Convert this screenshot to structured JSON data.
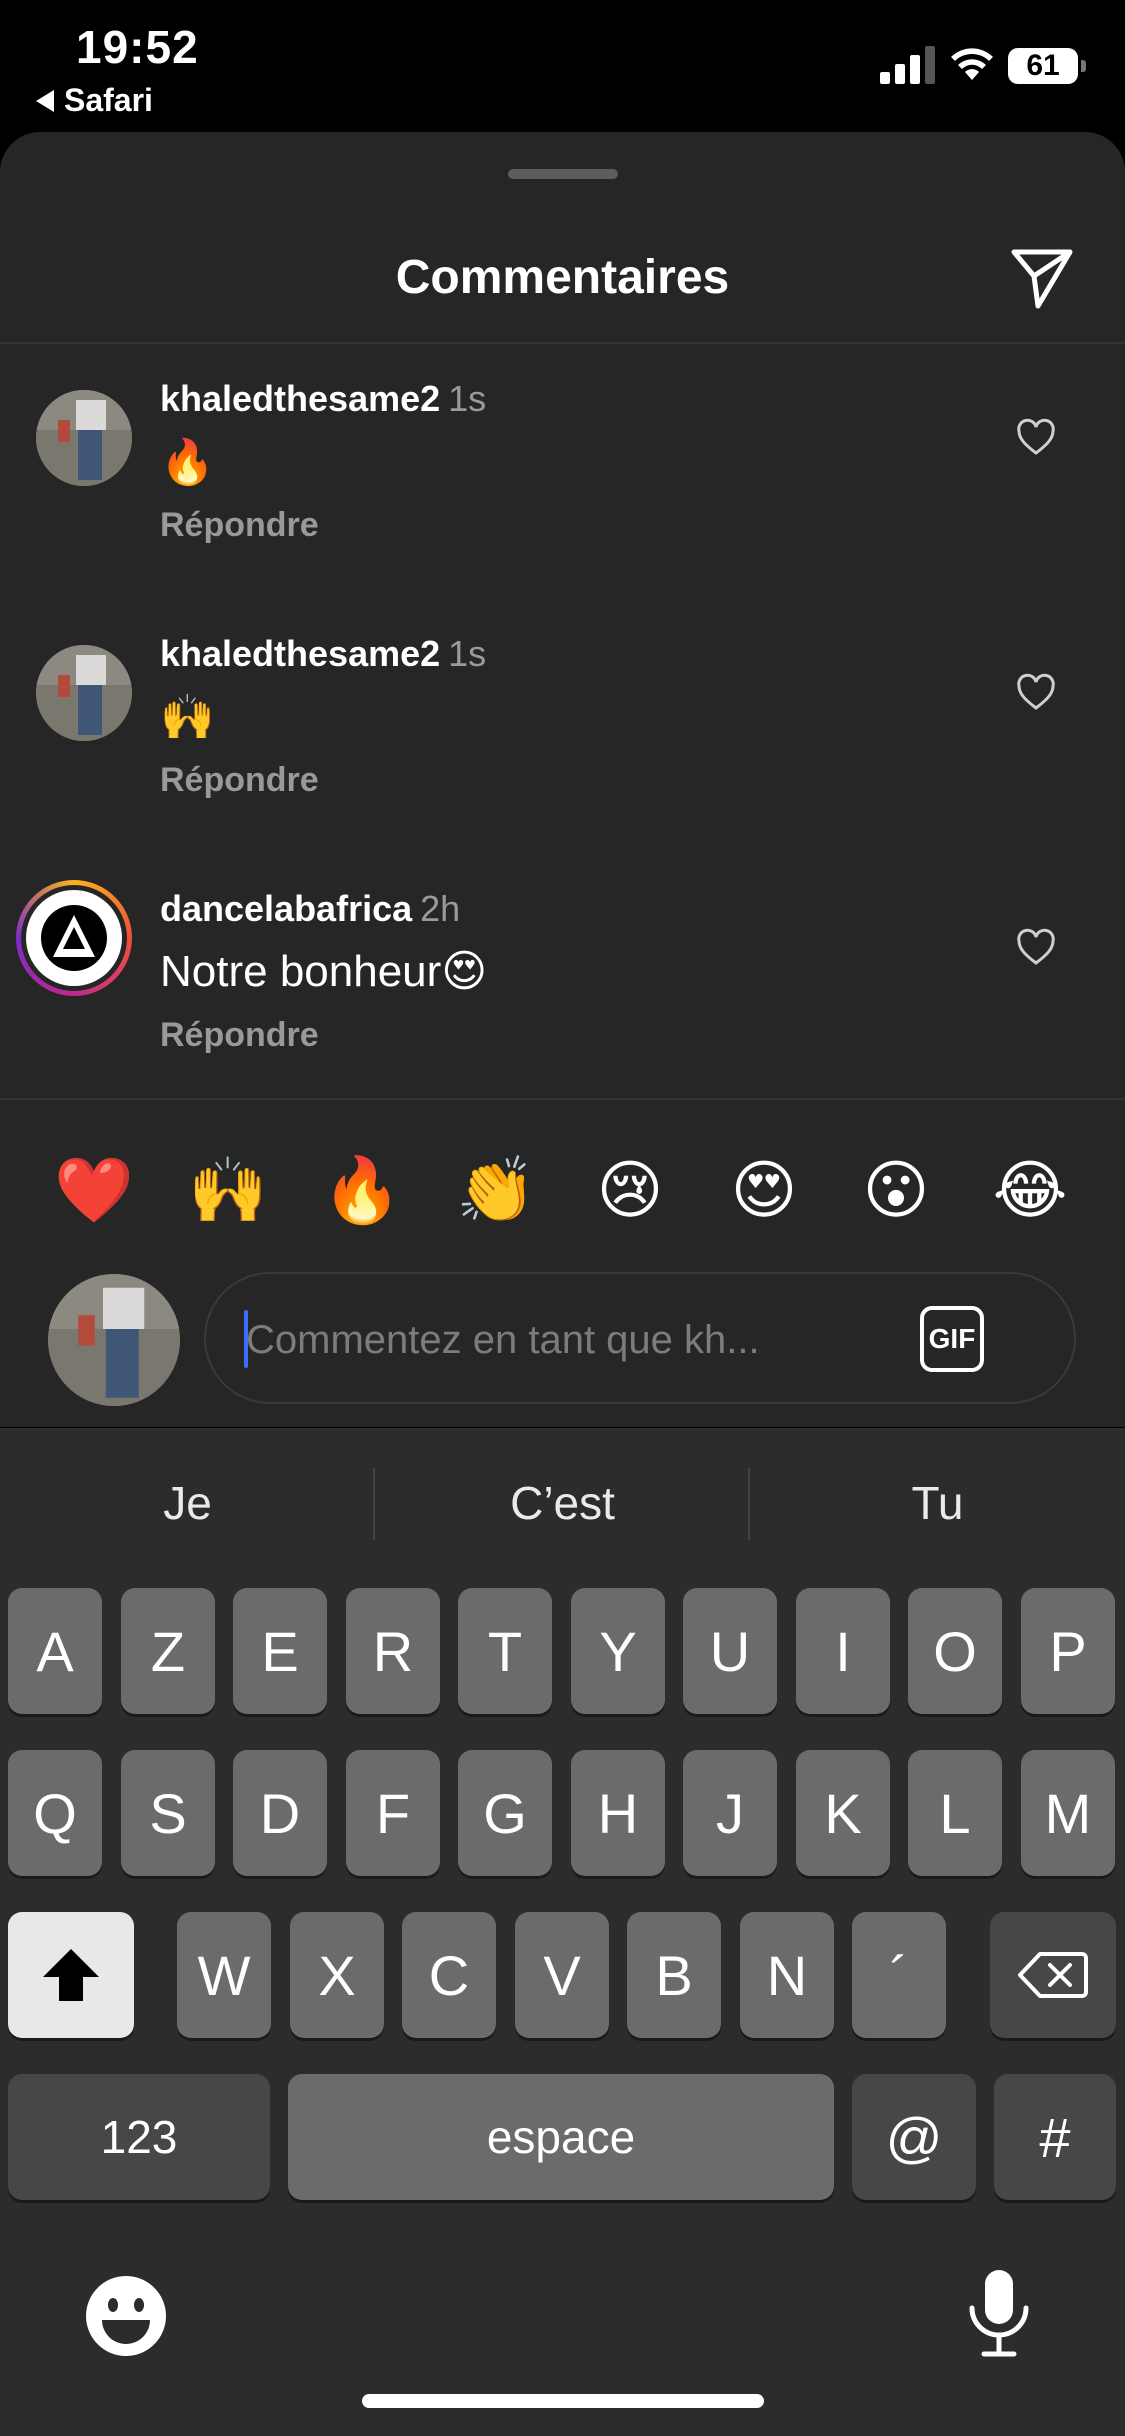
{
  "status_bar": {
    "time": "19:52",
    "back_app": "Safari",
    "battery": "61"
  },
  "sheet": {
    "title": "Commentaires"
  },
  "comments": [
    {
      "username": "khaledthesame2",
      "time": "1s",
      "text": "🔥",
      "reply": "Répondre"
    },
    {
      "username": "khaledthesame2",
      "time": "1s",
      "text": "🙌",
      "reply": "Répondre"
    },
    {
      "username": "dancelabafrica",
      "time": "2h",
      "text": "Notre bonheur😍",
      "reply": "Répondre"
    }
  ],
  "reactions": [
    "❤️",
    "🙌",
    "🔥",
    "👏",
    "😢",
    "😍",
    "😮",
    "😂"
  ],
  "composer": {
    "placeholder": "Commentez en tant que kh...",
    "value": "",
    "gif_label": "GIF"
  },
  "keyboard": {
    "suggestions": [
      "Je",
      "C’est",
      "Tu"
    ],
    "row1": [
      "A",
      "Z",
      "E",
      "R",
      "T",
      "Y",
      "U",
      "I",
      "O",
      "P"
    ],
    "row2": [
      "Q",
      "S",
      "D",
      "F",
      "G",
      "H",
      "J",
      "K",
      "L",
      "M"
    ],
    "row3": [
      "W",
      "X",
      "C",
      "V",
      "B",
      "N",
      "´"
    ],
    "numbers_label": "123",
    "space_label": "espace",
    "at_label": "@",
    "hash_label": "#"
  },
  "icons": [
    "send-icon",
    "heart-icon",
    "gif-icon",
    "shift-icon",
    "backspace-icon",
    "emoji-keyboard-icon",
    "microphone-icon"
  ]
}
